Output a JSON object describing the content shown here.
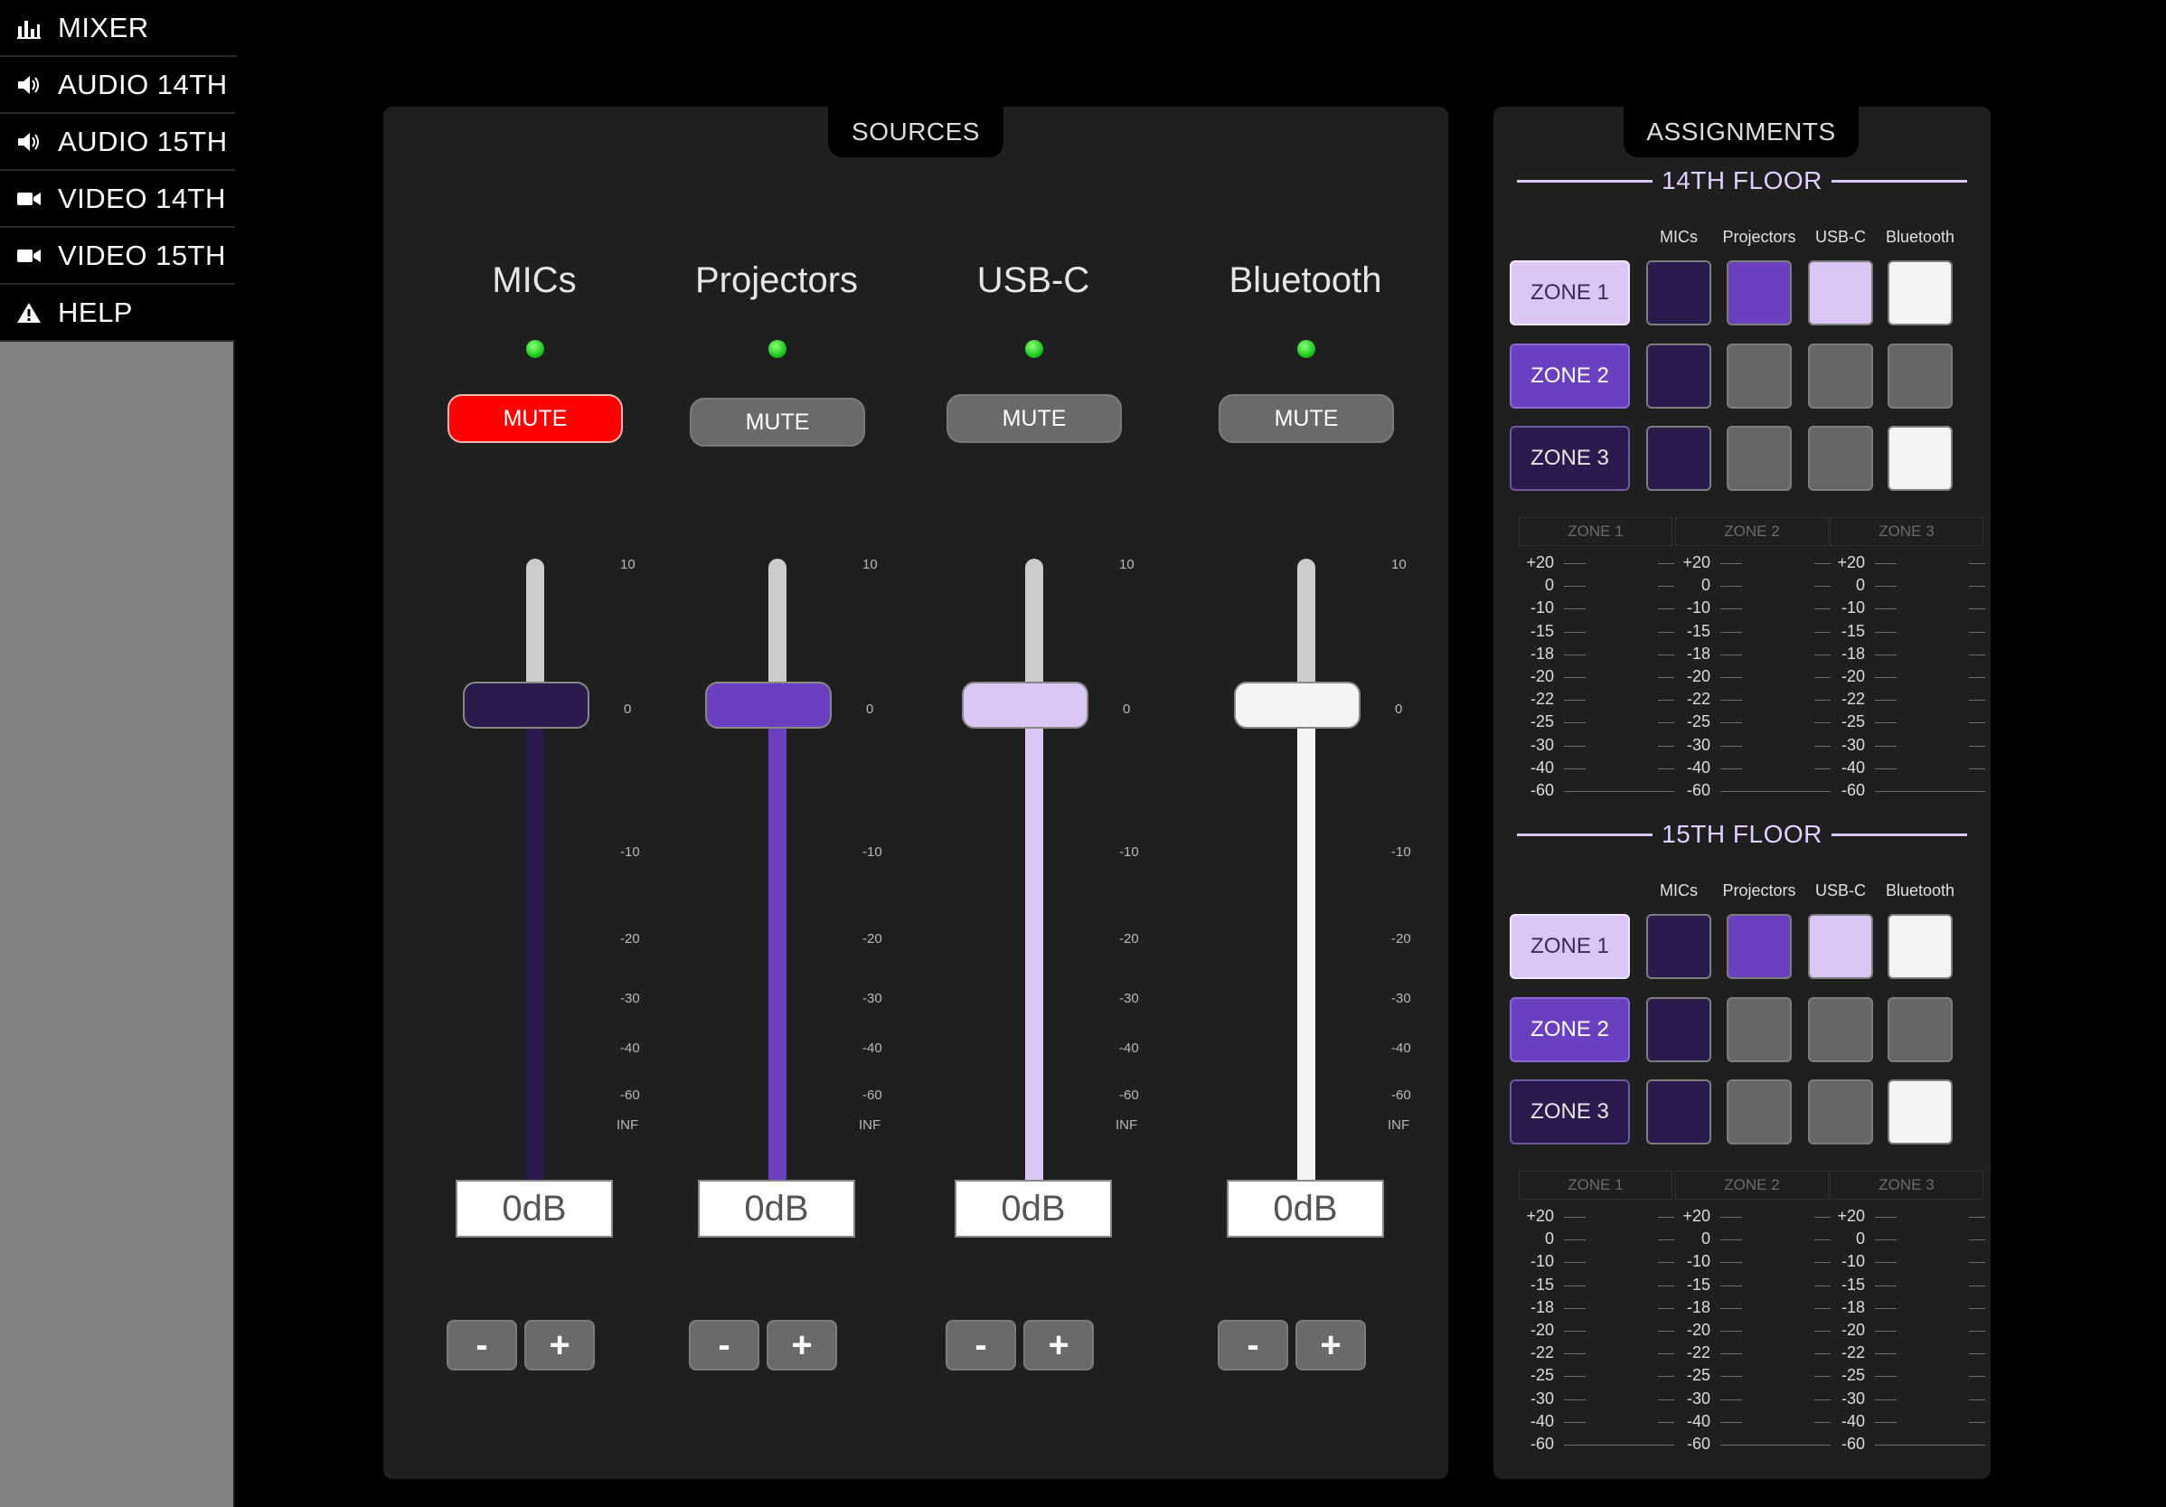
{
  "nav": {
    "items": [
      {
        "label": "MIXER",
        "icon": "bar-chart-icon"
      },
      {
        "label": "AUDIO 14TH",
        "icon": "speaker-icon"
      },
      {
        "label": "AUDIO 15TH",
        "icon": "speaker-icon"
      },
      {
        "label": "VIDEO 14TH",
        "icon": "video-camera-icon"
      },
      {
        "label": "VIDEO 15TH",
        "icon": "video-camera-icon"
      },
      {
        "label": "HELP",
        "icon": "warning-icon"
      }
    ],
    "active": "MIXER"
  },
  "sources": {
    "title": "SOURCES",
    "mute_label": "MUTE",
    "minus_label": "-",
    "plus_label": "+",
    "scale": [
      "10",
      "0",
      "-10",
      "-20",
      "-30",
      "-40",
      "-60",
      "INF"
    ],
    "channels": [
      {
        "name": "MICs",
        "muted": true,
        "level_db": "0dB",
        "color": "#2a1a4e"
      },
      {
        "name": "Projectors",
        "muted": false,
        "level_db": "0dB",
        "color": "#6a3fc0"
      },
      {
        "name": "USB-C",
        "muted": false,
        "level_db": "0dB",
        "color": "#dcc6f5"
      },
      {
        "name": "Bluetooth",
        "muted": false,
        "level_db": "0dB",
        "color": "#f4f4f4"
      }
    ]
  },
  "assignments": {
    "title": "ASSIGNMENTS",
    "columns": [
      "MICs",
      "Projectors",
      "USB-C",
      "Bluetooth"
    ],
    "meter_scale": [
      "+20",
      "0",
      "-10",
      "-15",
      "-18",
      "-20",
      "-22",
      "-25",
      "-30",
      "-40",
      "-60"
    ],
    "floors": [
      {
        "name": "14TH FLOOR",
        "zones": [
          {
            "label": "ZONE 1",
            "cells": [
              "#2a1a4e",
              "#6a3fc0",
              "#dcc6f5",
              "#f4f4f4"
            ]
          },
          {
            "label": "ZONE 2",
            "cells": [
              "#2a1a4e",
              "#666666",
              "#666666",
              "#666666"
            ]
          },
          {
            "label": "ZONE 3",
            "cells": [
              "#2a1a4e",
              "#666666",
              "#666666",
              "#f4f4f4"
            ]
          }
        ],
        "meters": [
          "ZONE 1",
          "ZONE 2",
          "ZONE 3"
        ]
      },
      {
        "name": "15TH FLOOR",
        "zones": [
          {
            "label": "ZONE 1",
            "cells": [
              "#2a1a4e",
              "#6a3fc0",
              "#dcc6f5",
              "#f4f4f4"
            ]
          },
          {
            "label": "ZONE 2",
            "cells": [
              "#2a1a4e",
              "#666666",
              "#666666",
              "#666666"
            ]
          },
          {
            "label": "ZONE 3",
            "cells": [
              "#2a1a4e",
              "#666666",
              "#666666",
              "#f4f4f4"
            ]
          }
        ],
        "meters": [
          "ZONE 1",
          "ZONE 2",
          "ZONE 3"
        ]
      }
    ]
  }
}
